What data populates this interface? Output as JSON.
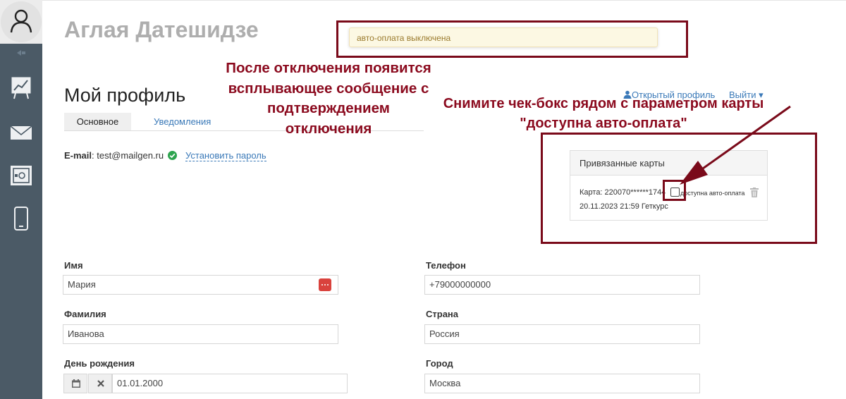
{
  "header": {
    "user_name": "Аглая Датешидзе",
    "notification": "авто-оплата выключена",
    "profile_title": "Мой профиль",
    "open_profile": "Открытый профиль",
    "logout": "Выйти ▾"
  },
  "tabs": [
    {
      "label": "Основное",
      "active": true
    },
    {
      "label": "Уведомления",
      "active": false
    }
  ],
  "email": {
    "label": "E-mail",
    "value": "test@mailgen.ru",
    "set_password": "Установить пароль"
  },
  "annotations": {
    "notice": "После отключения появится всплывающее сообщение с подтверждением отключения",
    "instruction": "Снимите чек-бокс рядом с параметром карты \"доступна авто-оплата\""
  },
  "cards": {
    "title": "Привязанные карты",
    "card_number": "Карта: 220070******1744",
    "auto_pay_label": "доступна авто-оплата",
    "auto_pay_checked": false,
    "date_line": "20.11.2023 21:59 Геткурс"
  },
  "form": {
    "first_name": {
      "label": "Имя",
      "value": "Мария"
    },
    "last_name": {
      "label": "Фамилия",
      "value": "Иванова"
    },
    "birthday": {
      "label": "День рождения",
      "value": "01.01.2000"
    },
    "phone": {
      "label": "Телефон",
      "value": "+79000000000"
    },
    "country": {
      "label": "Страна",
      "value": "Россия"
    },
    "city": {
      "label": "Город",
      "value": "Москва"
    }
  },
  "colors": {
    "sidebar": "#4b5a66",
    "annotation": "#8b0a1e",
    "link": "#3a79b8"
  },
  "icons": [
    "user-avatar-icon",
    "collapse-icon",
    "chart-icon",
    "mail-icon",
    "safe-icon",
    "phone-icon",
    "check-icon",
    "trash-icon",
    "dots-icon",
    "calendar-icon",
    "clear-icon",
    "arrow-annotation"
  ]
}
